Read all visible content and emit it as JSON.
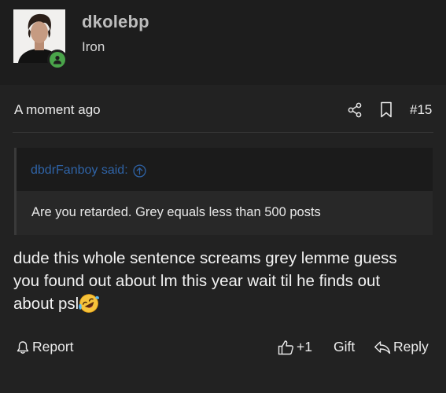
{
  "user": {
    "username": "dkolebp",
    "title": "Iron",
    "online": true
  },
  "post": {
    "timestamp": "A moment ago",
    "number": "#15",
    "quote": {
      "author_label": "dbdrFanboy said:",
      "text": "Are you retarded. Grey equals less than 500 posts"
    },
    "message_lines": [
      "dude this whole sentence screams grey lemme guess",
      "you found out about lm this year wait til he finds out",
      "about psl"
    ],
    "emoji": "rolling-on-floor-laughing"
  },
  "actions": {
    "report": "Report",
    "like_count": "+1",
    "gift": "Gift",
    "reply": "Reply"
  },
  "colors": {
    "background": "#222222",
    "header": "#1d1d1d",
    "quote_author": "#2f63a6",
    "online_badge": "#4aa44a"
  },
  "icons": [
    "share-icon",
    "bookmark-icon",
    "arrow-up-circle-icon",
    "bell-icon",
    "thumbs-up-icon",
    "reply-arrow-icon",
    "avatar-photo"
  ]
}
